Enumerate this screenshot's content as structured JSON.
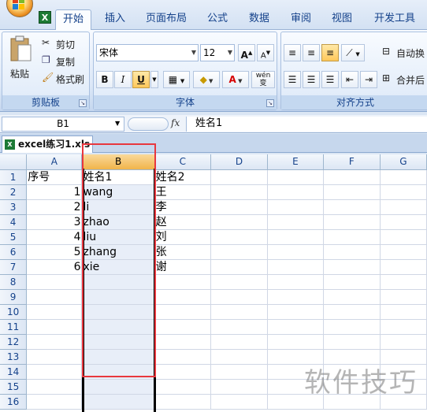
{
  "tabs": [
    {
      "label": "开始",
      "active": true
    },
    {
      "label": "插入",
      "active": false
    },
    {
      "label": "页面布局",
      "active": false
    },
    {
      "label": "公式",
      "active": false
    },
    {
      "label": "数据",
      "active": false
    },
    {
      "label": "审阅",
      "active": false
    },
    {
      "label": "视图",
      "active": false
    },
    {
      "label": "开发工具",
      "active": false
    }
  ],
  "clipboard": {
    "paste": "粘贴",
    "cut": "剪切",
    "copy": "复制",
    "format_painter": "格式刷",
    "group_label": "剪贴板"
  },
  "font": {
    "name": "宋体",
    "size": "12",
    "bold": "B",
    "italic": "I",
    "underline": "U",
    "text_color_glyph": "A",
    "wen": "wén 变",
    "grow": "A",
    "shrink": "A",
    "group_label": "字体"
  },
  "alignment": {
    "wrap": "自动换",
    "merge": "合并后",
    "group_label": "对齐方式"
  },
  "formula_bar": {
    "name_box": "B1",
    "fx": "fx",
    "content": "姓名1"
  },
  "workbook": {
    "tab_label": "excel练习1.xls"
  },
  "grid": {
    "columns": [
      "A",
      "B",
      "C",
      "D",
      "E",
      "F",
      "G"
    ],
    "selected_column": "B",
    "rows": [
      {
        "num": "1",
        "A": "序号",
        "B": "姓名1",
        "C": "姓名2"
      },
      {
        "num": "2",
        "A": "1",
        "B": "wang",
        "C": "王"
      },
      {
        "num": "3",
        "A": "2",
        "B": "li",
        "C": "李"
      },
      {
        "num": "4",
        "A": "3",
        "B": "zhao",
        "C": "赵"
      },
      {
        "num": "5",
        "A": "4",
        "B": "liu",
        "C": "刘"
      },
      {
        "num": "6",
        "A": "5",
        "B": "zhang",
        "C": "张"
      },
      {
        "num": "7",
        "A": "6",
        "B": "xie",
        "C": "谢"
      },
      {
        "num": "8"
      },
      {
        "num": "9"
      },
      {
        "num": "10"
      },
      {
        "num": "11"
      },
      {
        "num": "12"
      },
      {
        "num": "13"
      },
      {
        "num": "14"
      },
      {
        "num": "15"
      },
      {
        "num": "16"
      }
    ]
  },
  "watermark": "软件技巧",
  "colors": {
    "selection_outline": "#e8373e",
    "header_selected": "#f1b44a",
    "ribbon_text": "#15428b"
  }
}
